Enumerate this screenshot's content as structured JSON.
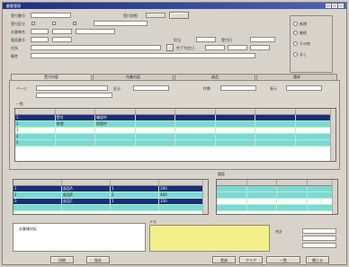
{
  "window": {
    "title": "顧客管理"
  },
  "top_fields": {
    "row1_label": "受付番号",
    "row1_status": "受付状態",
    "row2_label": "受付区分",
    "row3_label": "お客様名",
    "row4_label": "電話番号",
    "row5_label": "住所",
    "row6_label": "備考",
    "side_label1": "担当",
    "side_label2": "受付日",
    "side_label3": "完了予定日"
  },
  "radio_options": [
    "新規",
    "継続",
    "その他",
    "なし"
  ],
  "tabs": [
    "受付内容",
    "作業内容",
    "部品",
    "請求"
  ],
  "filter": {
    "label1": "ページ",
    "label2": "区分",
    "label3": "件数",
    "label4": "表示"
  },
  "main_grid": {
    "title": "一覧",
    "rows": [
      [
        "1",
        "受付",
        "確認中",
        "",
        "",
        "",
        "",
        ""
      ],
      [
        "2",
        "修理",
        "処理中",
        "",
        "",
        "",
        "",
        ""
      ],
      [
        "3",
        "",
        "",
        "",
        "",
        "",
        "",
        ""
      ],
      [
        "4",
        "",
        "",
        "",
        "",
        "",
        "",
        ""
      ],
      [
        "5",
        "",
        "",
        "",
        "",
        "",
        "",
        ""
      ]
    ]
  },
  "left_grid": {
    "rows": [
      [
        "1",
        "部品A",
        "1",
        "200"
      ],
      [
        "2",
        "部品B",
        "2",
        "400"
      ],
      [
        "3",
        "部品C",
        "1",
        "150"
      ],
      [
        "",
        "",
        "",
        ""
      ]
    ]
  },
  "right_grid": {
    "title": "履歴",
    "rows": [
      [
        "",
        "",
        "",
        ""
      ],
      [
        "",
        "",
        "",
        ""
      ],
      [
        "",
        "",
        "",
        ""
      ],
      [
        "",
        "",
        "",
        ""
      ]
    ]
  },
  "memo": {
    "label": "メモ",
    "text": "お客様対応"
  },
  "summary": {
    "label": "合計"
  },
  "bottom_buttons": [
    "印刷",
    "保存",
    "登録",
    "クリア",
    "一覧",
    "閉じる"
  ]
}
